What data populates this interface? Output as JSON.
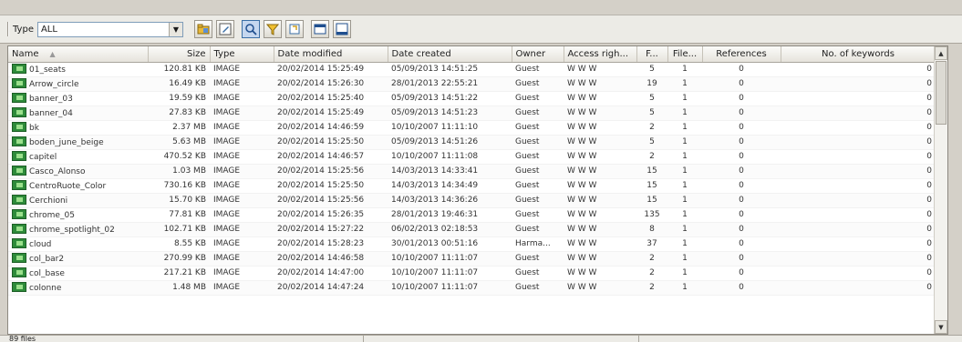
{
  "toolbar": {
    "type_label": "Type",
    "type_value": "ALL",
    "buttons": [
      "folder-icon",
      "edit-icon",
      "search-icon",
      "filter-icon",
      "tag-icon",
      "window-icon",
      "maximize-icon"
    ]
  },
  "table": {
    "columns": [
      "Name",
      "Size",
      "Type",
      "Date modified",
      "Date created",
      "Owner",
      "Access righ...",
      "F...",
      "File...",
      "References",
      "No. of keywords"
    ],
    "rows": [
      [
        "01_seats",
        "120.81 KB",
        "IMAGE",
        "20/02/2014 15:25:49",
        "05/09/2013 14:51:25",
        "Guest",
        "W W W",
        "5",
        "1",
        "0",
        "0"
      ],
      [
        "Arrow_circle",
        "16.49 KB",
        "IMAGE",
        "20/02/2014 15:26:30",
        "28/01/2013 22:55:21",
        "Guest",
        "W W W",
        "19",
        "1",
        "0",
        "0"
      ],
      [
        "banner_03",
        "19.59 KB",
        "IMAGE",
        "20/02/2014 15:25:40",
        "05/09/2013 14:51:22",
        "Guest",
        "W W W",
        "5",
        "1",
        "0",
        "0"
      ],
      [
        "banner_04",
        "27.83 KB",
        "IMAGE",
        "20/02/2014 15:25:49",
        "05/09/2013 14:51:23",
        "Guest",
        "W W W",
        "5",
        "1",
        "0",
        "0"
      ],
      [
        "bk",
        "2.37 MB",
        "IMAGE",
        "20/02/2014 14:46:59",
        "10/10/2007 11:11:10",
        "Guest",
        "W W W",
        "2",
        "1",
        "0",
        "0"
      ],
      [
        "boden_june_beige",
        "5.63 MB",
        "IMAGE",
        "20/02/2014 15:25:50",
        "05/09/2013 14:51:26",
        "Guest",
        "W W W",
        "5",
        "1",
        "0",
        "0"
      ],
      [
        "capitel",
        "470.52 KB",
        "IMAGE",
        "20/02/2014 14:46:57",
        "10/10/2007 11:11:08",
        "Guest",
        "W W W",
        "2",
        "1",
        "0",
        "0"
      ],
      [
        "Casco_Alonso",
        "1.03 MB",
        "IMAGE",
        "20/02/2014 15:25:56",
        "14/03/2013 14:33:41",
        "Guest",
        "W W W",
        "15",
        "1",
        "0",
        "0"
      ],
      [
        "CentroRuote_Color",
        "730.16 KB",
        "IMAGE",
        "20/02/2014 15:25:50",
        "14/03/2013 14:34:49",
        "Guest",
        "W W W",
        "15",
        "1",
        "0",
        "0"
      ],
      [
        "Cerchioni",
        "15.70 KB",
        "IMAGE",
        "20/02/2014 15:25:56",
        "14/03/2013 14:36:26",
        "Guest",
        "W W W",
        "15",
        "1",
        "0",
        "0"
      ],
      [
        "chrome_05",
        "77.81 KB",
        "IMAGE",
        "20/02/2014 15:26:35",
        "28/01/2013 19:46:31",
        "Guest",
        "W W W",
        "135",
        "1",
        "0",
        "0"
      ],
      [
        "chrome_spotlight_02",
        "102.71 KB",
        "IMAGE",
        "20/02/2014 15:27:22",
        "06/02/2013 02:18:53",
        "Guest",
        "W W W",
        "8",
        "1",
        "0",
        "0"
      ],
      [
        "cloud",
        "8.55 KB",
        "IMAGE",
        "20/02/2014 15:28:23",
        "30/01/2013 00:51:16",
        "Harma...",
        "W W W",
        "37",
        "1",
        "0",
        "0"
      ],
      [
        "col_bar2",
        "270.99 KB",
        "IMAGE",
        "20/02/2014 14:46:58",
        "10/10/2007 11:11:07",
        "Guest",
        "W W W",
        "2",
        "1",
        "0",
        "0"
      ],
      [
        "col_base",
        "217.21 KB",
        "IMAGE",
        "20/02/2014 14:47:00",
        "10/10/2007 11:11:07",
        "Guest",
        "W W W",
        "2",
        "1",
        "0",
        "0"
      ],
      [
        "colonne",
        "1.48 MB",
        "IMAGE",
        "20/02/2014 14:47:24",
        "10/10/2007 11:11:07",
        "Guest",
        "W W W",
        "2",
        "1",
        "0",
        "0"
      ]
    ]
  },
  "status": {
    "file_count": "89 files"
  },
  "colors": {
    "icon_green": "#2e8b3a",
    "toolbar_bg": "#ecebe6"
  }
}
